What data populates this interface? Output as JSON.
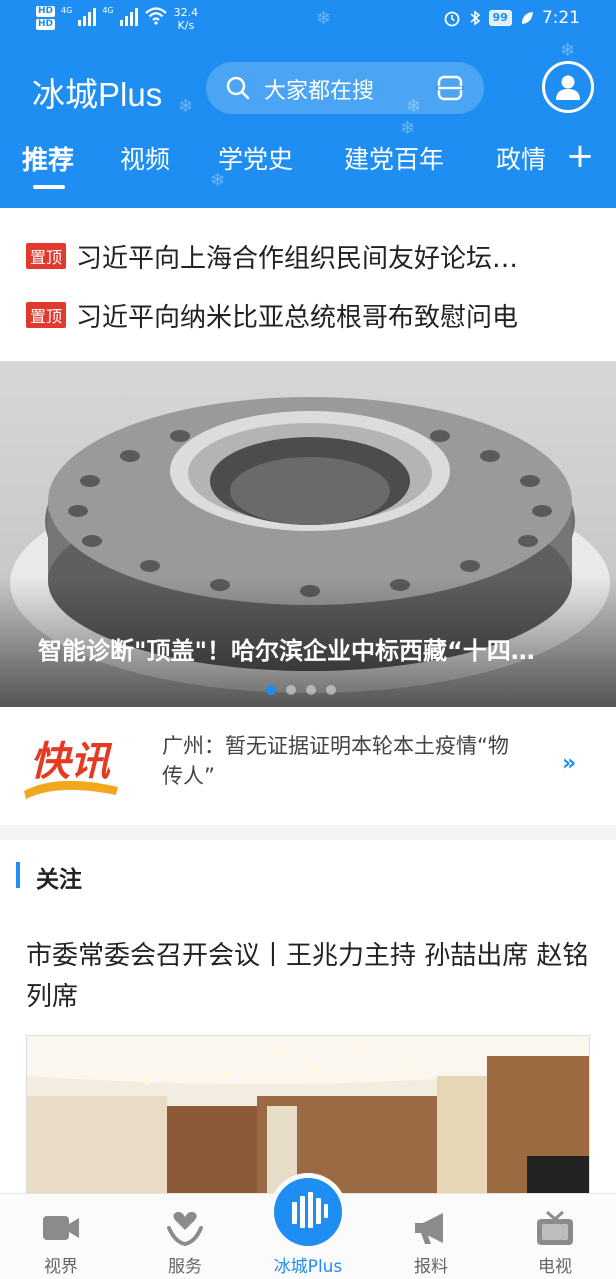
{
  "status_bar": {
    "hd1": "HD",
    "hd2": "HD",
    "sig1": "4G",
    "sig2": "4G",
    "speed": "32.4",
    "speed_unit": "K/s",
    "battery": "99",
    "time": "7:21"
  },
  "header": {
    "app_name": "冰城Plus",
    "search_placeholder": "大家都在搜"
  },
  "tabs": [
    {
      "label": "推荐",
      "active": true
    },
    {
      "label": "视频",
      "active": false
    },
    {
      "label": "学党史",
      "active": false
    },
    {
      "label": "建党百年",
      "active": false
    },
    {
      "label": "政情",
      "active": false
    }
  ],
  "pinned": {
    "badge": "置顶",
    "items": [
      "习近平向上海合作组织民间友好论坛…",
      "习近平向纳米比亚总统根哥布致慰问电"
    ]
  },
  "banner": {
    "caption": "智能诊断\"顶盖\"！哈尔滨企业中标西藏“十四…",
    "slide_index": 1,
    "slide_count": 4
  },
  "flash": {
    "logo_text": "快讯",
    "text": "广州：暂无证据证明本轮本土疫情“物传人”",
    "arrow": "››"
  },
  "follow": {
    "section_title": "关注",
    "article_title": "市委常委会召开会议丨王兆力主持 孙喆出席 赵铭列席"
  },
  "bottom_nav": [
    {
      "label": "视界",
      "icon": "video-camera-icon"
    },
    {
      "label": "服务",
      "icon": "heart-hand-icon"
    },
    {
      "label": "冰城Plus",
      "icon": "plus-logo-icon",
      "active": true
    },
    {
      "label": "报料",
      "icon": "megaphone-icon"
    },
    {
      "label": "电视",
      "icon": "tv-icon"
    }
  ],
  "colors": {
    "brand_blue": "#1f8ef2",
    "pin_red": "#e03a2f"
  }
}
